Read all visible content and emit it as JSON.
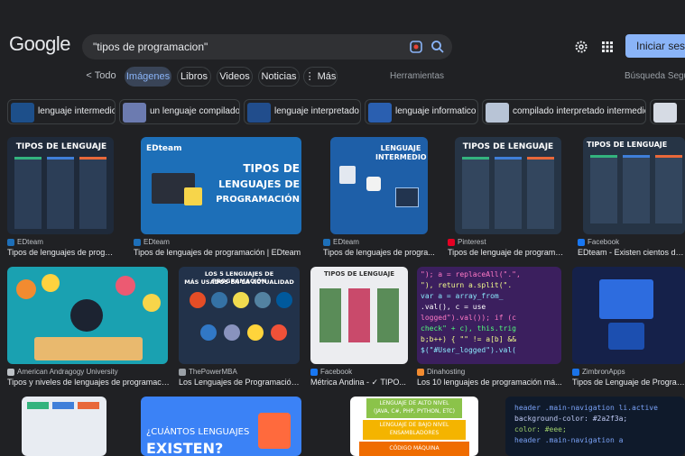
{
  "header": {
    "logo": "Google",
    "query": "\"tipos de programacion\"",
    "signin_label": "Iniciar sesión"
  },
  "tabs": [
    {
      "label": "< Todo"
    },
    {
      "label": "Imágenes"
    },
    {
      "label": "Libros"
    },
    {
      "label": "Videos"
    },
    {
      "label": "Noticias"
    },
    {
      "label": "⋮ Más"
    }
  ],
  "tools_label": "Herramientas",
  "safe_search_label": "Búsqueda Segura",
  "chips": [
    {
      "label": "lenguaje intermedio"
    },
    {
      "label": "un lenguaje compilado"
    },
    {
      "label": "lenguaje interpretado"
    },
    {
      "label": "lenguaje informatico"
    },
    {
      "label": "compilado interpretado intermedio"
    }
  ],
  "results": {
    "row1": [
      {
        "source": "EDteam",
        "title": "Tipos de lenguajes de progra..."
      },
      {
        "source": "EDteam",
        "title": "Tipos de lenguajes de programación | EDteam"
      },
      {
        "source": "EDteam",
        "title": "Tipos de lenguajes de progra..."
      },
      {
        "source": "Pinterest",
        "title": "Tipos de lenguaje de programa..."
      },
      {
        "source": "Facebook",
        "title": "EDteam - Existen cientos de len"
      }
    ],
    "row2": [
      {
        "source": "American Andragogy University",
        "title": "Tipos y niveles de lenguajes de programació..."
      },
      {
        "source": "ThePowerMBA",
        "title": "Los Lenguajes de Programación..."
      },
      {
        "source": "Facebook",
        "title": "Métrica Andina - ✓ TIPO..."
      },
      {
        "source": "Dinahosting",
        "title": "Los 10 lenguajes de programación má..."
      },
      {
        "source": "ZimbronApps",
        "title": "Tipos de Lenguaje de Programac"
      }
    ]
  },
  "image_text": {
    "tipos_lenguaje": "TIPOS DE LENGUAJE",
    "compilado": "COMPILADO",
    "interpretado": "INTERPRETADO",
    "intermedio": "INTERMEDIO",
    "edteam_logo": "EDteam",
    "edteam_tipos_1": "TIPOS DE",
    "edteam_tipos_2": "LENGUAJES DE",
    "edteam_tipos_3": "PROGRAMACIÓN",
    "lenguaje_intermedio_1": "LENGUAJE",
    "lenguaje_intermedio_2": "INTERMEDIO",
    "power_title_1": "LOS 5 LENGUAJES DE PROGRAMACIÓN",
    "power_title_2": "MÁS USADOS EN LA ACTUALIDAD",
    "metrica_title": "TIPOS DE LENGUAJE",
    "cuantos_1": "¿CUÁNTOS LENGUAJES",
    "cuantos_2": "EXISTEN?",
    "nivel_alto": "LENGUAJE DE ALTO NIVEL",
    "nivel_alto_sub": "(JAVA, C#, PHP, PYTHON, ETC)",
    "nivel_bajo": "LENGUAJE DE BAJO NIVEL",
    "nivel_bajo_sub": "ENSAMBLADORES",
    "codigo_maquina": "CÓDIGO MÁQUINA"
  },
  "colors": {
    "background": "#202124",
    "accent": "#8ab4f8",
    "edteam_blue": "#1d6fb8",
    "teal": "#1aa1b1"
  }
}
